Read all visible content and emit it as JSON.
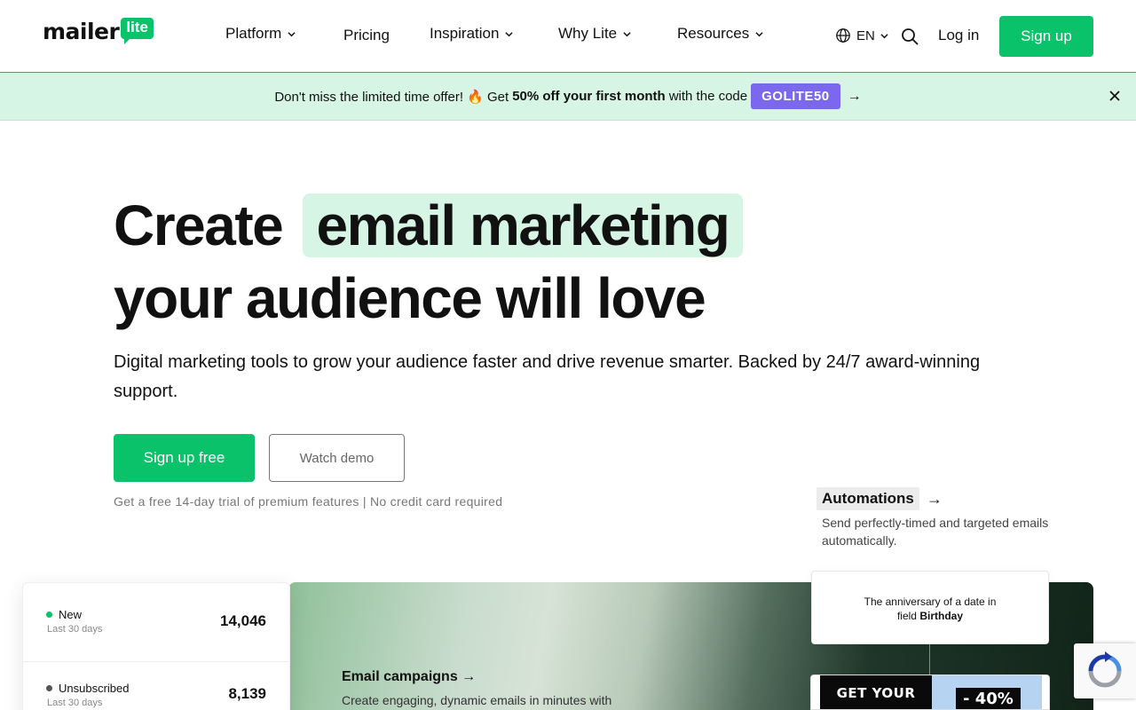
{
  "header": {
    "logo": {
      "word": "mailer",
      "badge": "lite"
    },
    "nav": [
      {
        "label": "Platform",
        "has_dropdown": true
      },
      {
        "label": "Pricing",
        "has_dropdown": false
      },
      {
        "label": "Inspiration",
        "has_dropdown": true
      },
      {
        "label": "Why Lite",
        "has_dropdown": true
      },
      {
        "label": "Resources",
        "has_dropdown": true
      }
    ],
    "language": "EN",
    "login_label": "Log in",
    "signup_label": "Sign up"
  },
  "promo": {
    "text_before": "Don't miss the limited time offer! 🔥 Get",
    "text_bold": "50% off your first month",
    "text_after": "with the code",
    "code": "GOLITE50",
    "arrow": "→"
  },
  "hero": {
    "line1_prefix": "Create",
    "line1_highlight": "email marketing",
    "line2": "your audience will love",
    "subtitle": "Digital marketing tools to grow your audience faster and drive revenue smarter. Backed by 24/7 award-winning support.",
    "cta_primary": "Sign up free",
    "cta_secondary": "Watch demo",
    "trial_note": "Get a free 14-day trial of premium features | No credit card required"
  },
  "automations": {
    "title": "Automations",
    "arrow": "→",
    "description": "Send perfectly-timed and targeted emails automatically."
  },
  "stats_card": {
    "rows": [
      {
        "label": "New",
        "sublabel": "Last 30 days",
        "value": "14,046",
        "dot_color": "#09c269"
      },
      {
        "label": "Unsubscribed",
        "sublabel": "Last 30 days",
        "value": "8,139",
        "dot_color": "#555555"
      }
    ]
  },
  "campaigns": {
    "title": "Email campaigns →",
    "description": "Create engaging, dynamic emails in minutes with"
  },
  "trigger_card": {
    "line1": "The anniversary of a date in",
    "prefix": "field",
    "field": "Birthday"
  },
  "email_preview": {
    "left_text": "GET YOUR",
    "badge": "- 40%"
  },
  "colors": {
    "brand_green": "#09c269",
    "promo_bg": "#d6f5e4",
    "code_purple": "#7b68ee"
  }
}
